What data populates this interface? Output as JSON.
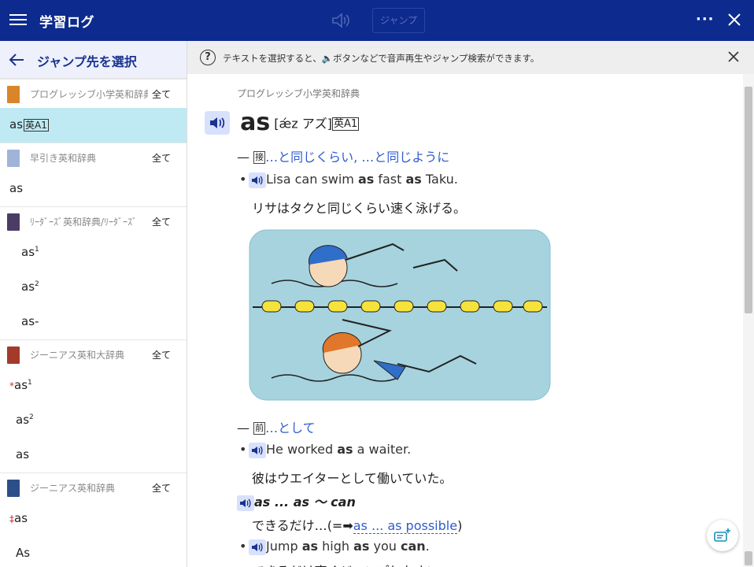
{
  "topbar": {
    "title": "学習ログ",
    "jump_label": "ジャンプ",
    "more_label": "···"
  },
  "sidebar": {
    "header": "ジャンプ先を選択",
    "all_label": "全て",
    "groups": [
      {
        "dict": "プログレッシブ小学英和辞典",
        "color": "#d9852a",
        "entries": [
          {
            "text": "as",
            "badge": "英A1",
            "active": true
          }
        ]
      },
      {
        "dict": "早引き英和辞典",
        "color": "#9fb4d8",
        "entries": [
          {
            "text": "as"
          }
        ]
      },
      {
        "dict": "ﾘｰﾀﾞｰｽﾞ英和辞典/ﾘｰﾀﾞｰｽﾞ",
        "color": "#4b3c66",
        "entries": [
          {
            "text": "as",
            "sup": "1"
          },
          {
            "text": "as",
            "sup": "2"
          },
          {
            "text": "as-"
          }
        ]
      },
      {
        "dict": "ジーニアス英和大辞典",
        "color": "#a33a2a",
        "entries": [
          {
            "prefix": "*",
            "text": "as",
            "sup": "1"
          },
          {
            "text": "as",
            "sup": "2"
          },
          {
            "text": "as"
          }
        ]
      },
      {
        "dict": "ジーニアス英和辞典",
        "color": "#2c4f8a",
        "entries": [
          {
            "prefix": "‡",
            "text": "as"
          },
          {
            "text": "As"
          }
        ]
      }
    ]
  },
  "notice": {
    "message": "テキストを選択すると、🔈ボタンなどで音声再生やジャンプ検索ができます。",
    "icon": "question-circle-icon"
  },
  "content": {
    "source": "プログレッシブ小学英和辞典",
    "headword": "as",
    "pronunciation": "[ǽz アズ]",
    "level_badge": "英A1",
    "sense1": {
      "pos": "接",
      "gloss": "…と同じくらい, …と同じように"
    },
    "ex1_en": {
      "pre": "Lisa can swim ",
      "b1": "as",
      "mid": " fast ",
      "b2": "as",
      "post": " Taku."
    },
    "ex1_jp": "リサはタクと同じくらい速く泳げる。",
    "sense2": {
      "pos": "前",
      "gloss": "…として"
    },
    "ex2_en": {
      "pre": "He worked ",
      "b1": "as",
      "post": " a waiter."
    },
    "ex2_jp": "彼はウエイターとして働いていた。",
    "phrase": "as ... as ～ can",
    "phrase_jp": "できるだけ…",
    "phrase_ref_arrow": "(=➡",
    "phrase_ref": "as ... as possible",
    "phrase_ref_close": ")",
    "ex3_en": {
      "pre": "Jump ",
      "b1": "as",
      "mid1": " high ",
      "b2": "as",
      "mid2": " you ",
      "b3": "can",
      "post": "."
    },
    "ex3_jp_partial": "できるだけ高くジャンプしなさい。"
  }
}
